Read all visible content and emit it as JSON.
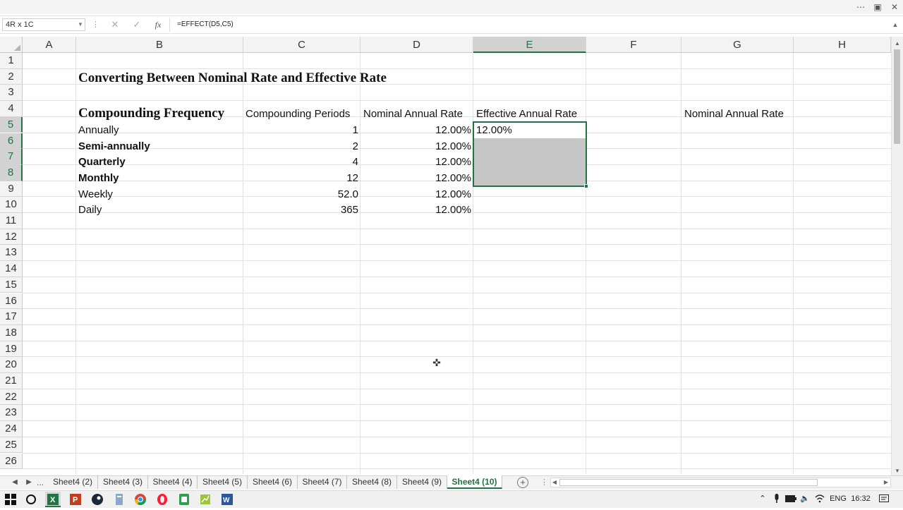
{
  "formula_bar": {
    "name_box": "4R x 1C",
    "formula": "=EFFECT(D5,C5)"
  },
  "columns": [
    "A",
    "B",
    "C",
    "D",
    "E",
    "F",
    "G",
    "H"
  ],
  "rows": [
    "1",
    "2",
    "3",
    "4",
    "5",
    "6",
    "7",
    "8",
    "9",
    "10",
    "11",
    "12",
    "13",
    "14",
    "15",
    "16",
    "17",
    "18",
    "19",
    "20",
    "21",
    "22",
    "23",
    "24",
    "25",
    "26"
  ],
  "sheet": {
    "title": "Converting Between Nominal Rate and Effective Rate",
    "headers": {
      "frequency": "Compounding Frequency",
      "periods": "Compounding Periods",
      "nominal": "Nominal Annual Rate",
      "effective": "Effective Annual Rate",
      "nominal_g": "Nominal Annual Rate"
    },
    "data_rows": [
      {
        "frequency": "Annually",
        "periods": "1",
        "nominal": "12.00%",
        "effective": "12.00%"
      },
      {
        "frequency": "Semi-annually",
        "periods": "2",
        "nominal": "12.00%",
        "effective": ""
      },
      {
        "frequency": "Quarterly",
        "periods": "4",
        "nominal": "12.00%",
        "effective": ""
      },
      {
        "frequency": "Monthly",
        "periods": "12",
        "nominal": "12.00%",
        "effective": ""
      },
      {
        "frequency": "Weekly",
        "periods": "52.0",
        "nominal": "12.00%",
        "effective": ""
      },
      {
        "frequency": "Daily",
        "periods": "365",
        "nominal": "12.00%",
        "effective": ""
      }
    ]
  },
  "sheet_tabs": {
    "ellipsis": "...",
    "tabs": [
      "Sheet4 (2)",
      "Sheet4 (3)",
      "Sheet4 (4)",
      "Sheet4 (5)",
      "Sheet4 (6)",
      "Sheet4 (7)",
      "Sheet4 (8)",
      "Sheet4 (9)",
      "Sheet4 (10)"
    ],
    "active": "Sheet4 (10)"
  },
  "taskbar": {
    "language": "ENG",
    "time": "16:32"
  },
  "colors": {
    "accent": "#217346",
    "selection_fill": "#c6c6c6"
  }
}
